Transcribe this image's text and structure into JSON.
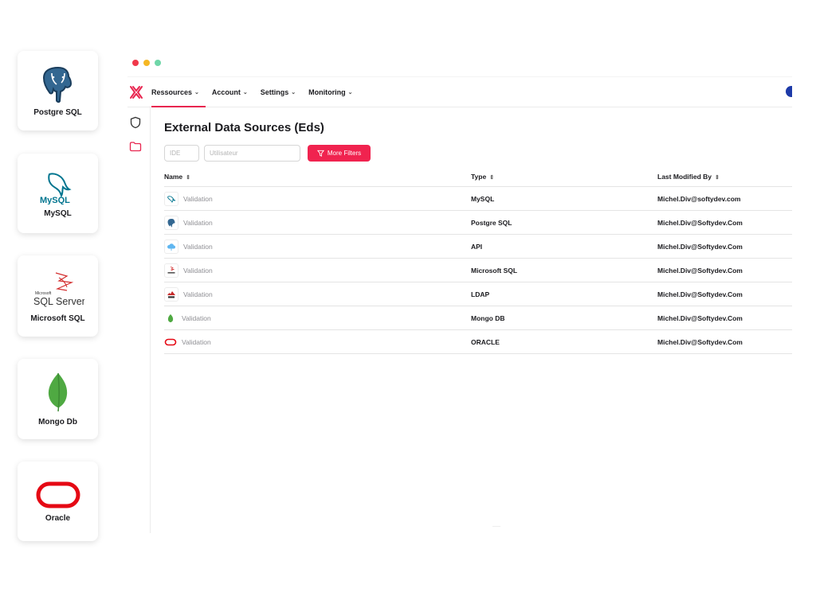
{
  "cards": [
    {
      "label": "Postgre SQL",
      "icon": "postgresql-elephant-icon"
    },
    {
      "label": "MySQL",
      "icon": "mysql-dolphin-icon",
      "logo_text": "MySQL"
    },
    {
      "label": "Microsoft SQL",
      "icon": "sql-server-icon",
      "logo_text": "SQL Server",
      "logo_small": "Microsoft"
    },
    {
      "label": "Mongo Db",
      "icon": "mongodb-leaf-icon"
    },
    {
      "label": "Oracle",
      "icon": "oracle-ring-icon"
    }
  ],
  "window": {
    "dot_colors": [
      "#f0384a",
      "#f5b724",
      "#6fd6a8"
    ]
  },
  "nav": {
    "items": [
      {
        "label": "Ressources",
        "active": true
      },
      {
        "label": "Account",
        "active": false
      },
      {
        "label": "Settings",
        "active": false
      },
      {
        "label": "Monitoring",
        "active": false
      }
    ]
  },
  "page": {
    "title": "External Data Sources (Eds)",
    "filters": {
      "ide_placeholder": "IDE",
      "user_placeholder": "Utilisateur",
      "more_filters_label": "More Filters"
    }
  },
  "table": {
    "columns": [
      "Name",
      "Type",
      "Last Modified By"
    ],
    "rows": [
      {
        "icon": "mysql-icon",
        "name": "Validation",
        "type": "MySQL",
        "modified_by": "Michel.Div@softydev.com"
      },
      {
        "icon": "postgresql-icon",
        "name": "Validation",
        "type": "Postgre SQL",
        "modified_by": "Michel.Div@Softydev.Com"
      },
      {
        "icon": "api-cloud-icon",
        "name": "Validation",
        "type": "API",
        "modified_by": "Michel.Div@Softydev.Com"
      },
      {
        "icon": "sql-server-icon",
        "name": "Validation",
        "type": "Microsoft SQL",
        "modified_by": "Michel.Div@Softydev.Com"
      },
      {
        "icon": "ldap-icon",
        "name": "Validation",
        "type": "LDAP",
        "modified_by": "Michel.Div@Softydev.Com"
      },
      {
        "icon": "mongodb-icon",
        "name": "Validation",
        "type": "Mongo DB",
        "modified_by": "Michel.Div@Softydev.Com"
      },
      {
        "icon": "oracle-icon",
        "name": "Validation",
        "type": "ORACLE",
        "modified_by": "Michel.Div@Softydev.Com"
      }
    ]
  },
  "colors": {
    "accent": "#f0234f",
    "text": "#1b1b1f",
    "muted": "#8e8e93"
  }
}
